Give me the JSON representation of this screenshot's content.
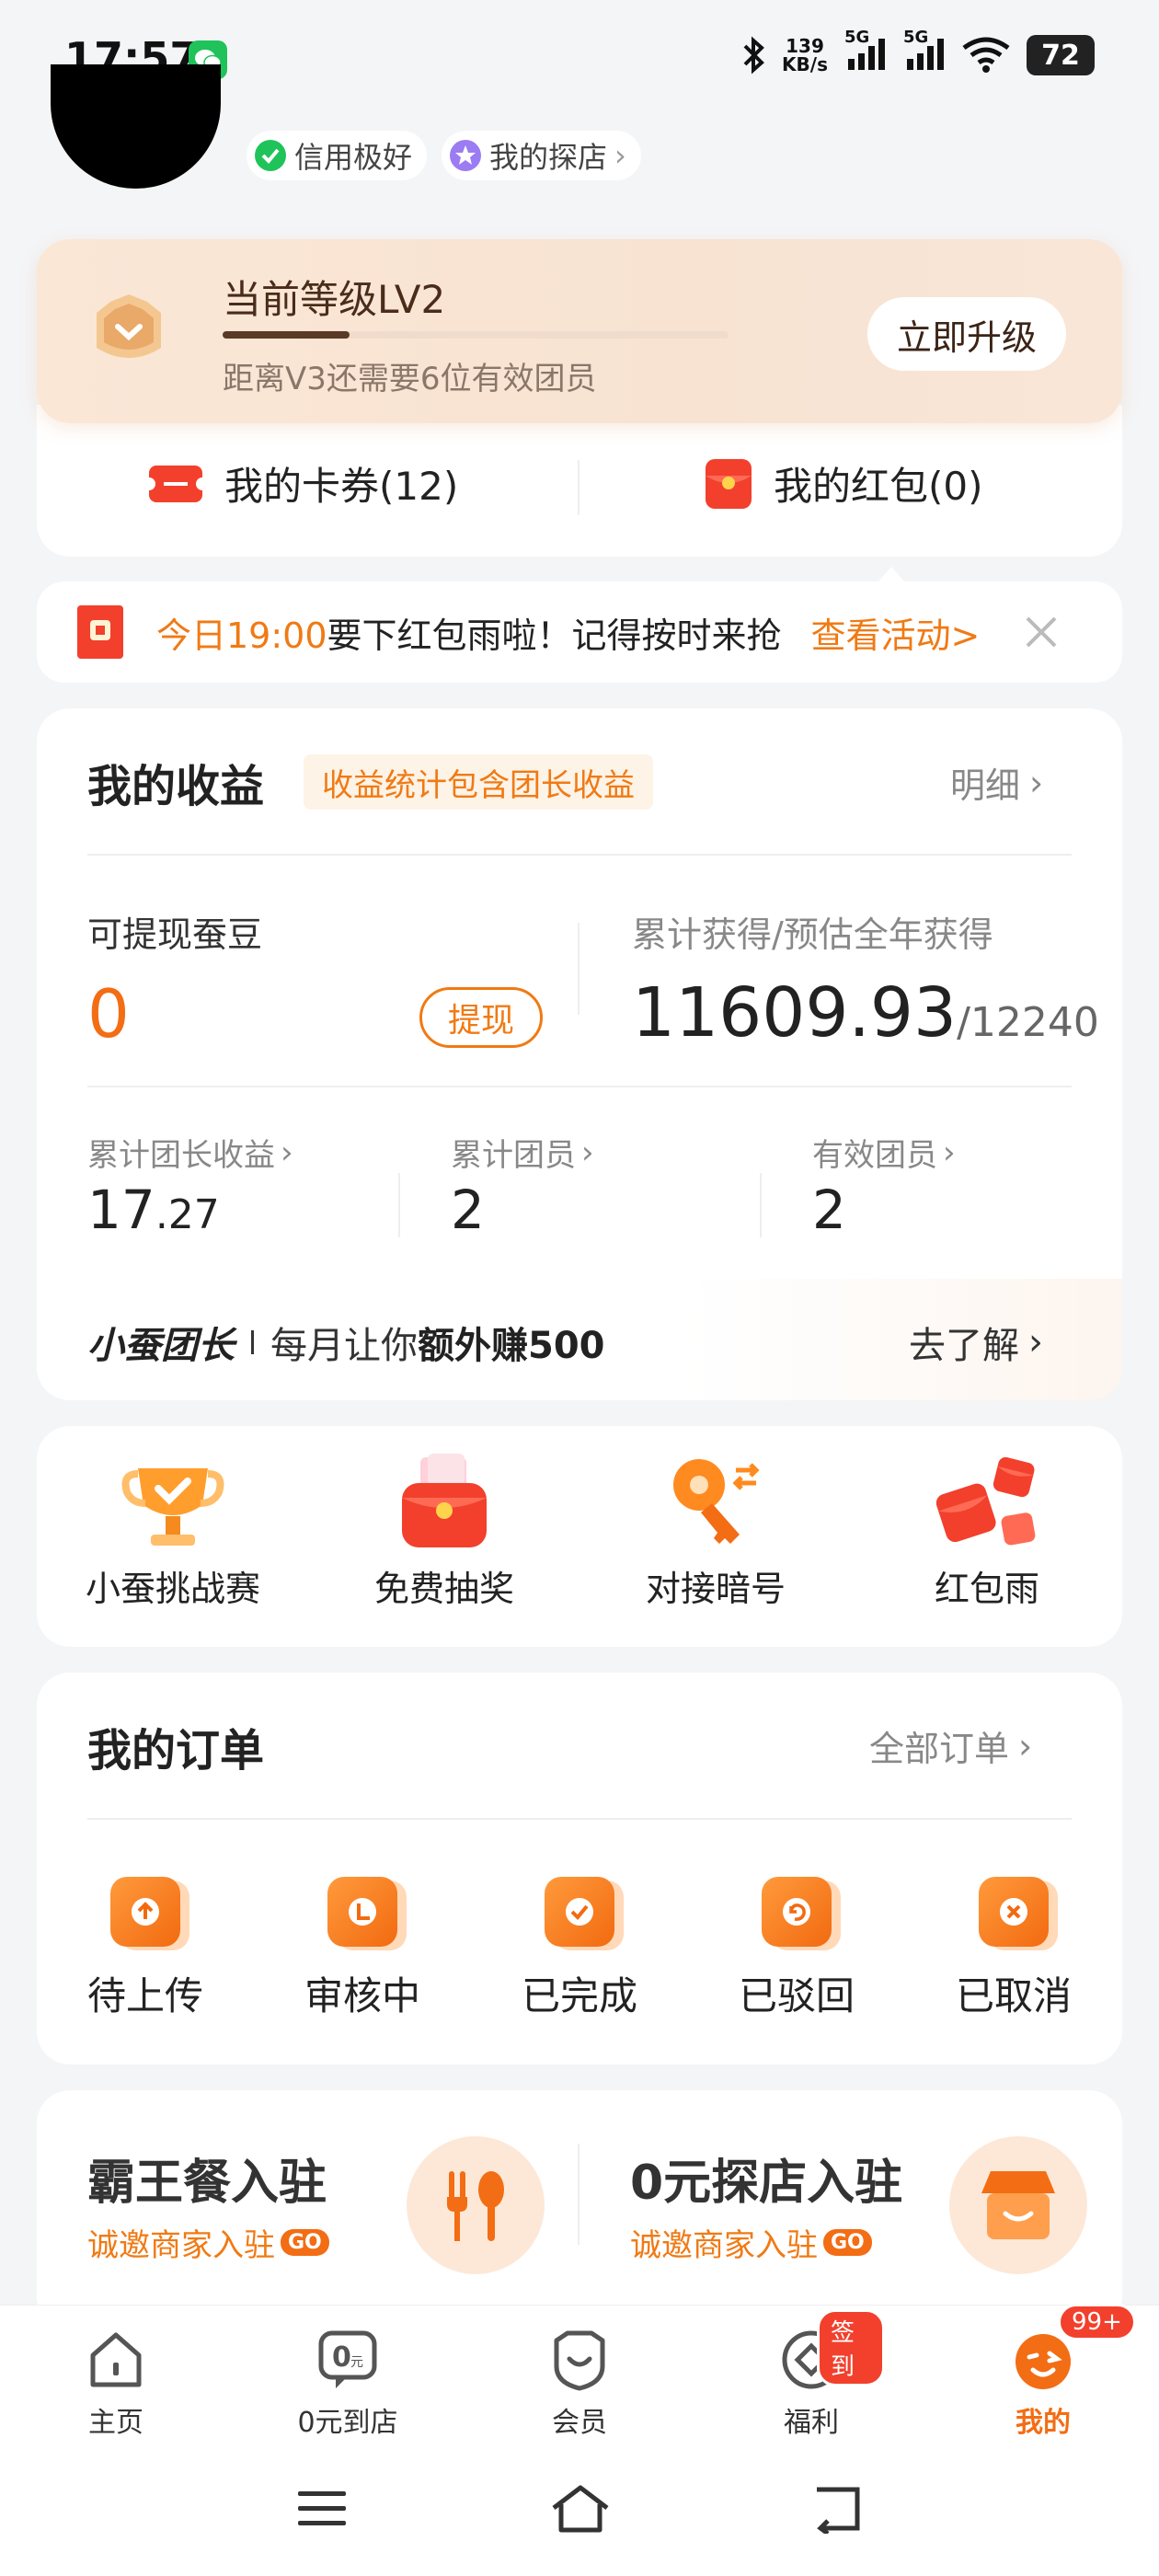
{
  "status_bar": {
    "time": "17:57",
    "net_speed_value": "139",
    "net_speed_unit": "KB/s",
    "sim1": "5G",
    "sim2": "5G",
    "battery": "72"
  },
  "profile": {
    "credit_label": "信用极好",
    "explore_label": "我的探店"
  },
  "level": {
    "title": "当前等级LV2",
    "progress": 0.25,
    "subtitle": "距离V3还需要6位有效团员",
    "upgrade_button": "立即升级"
  },
  "wallet": {
    "coupons_label": "我的卡券(12)",
    "red_packets_label": "我的红包(0)"
  },
  "notice": {
    "time_text": "今日19:00",
    "message": "要下红包雨啦！记得按时来抢",
    "link": "查看活动>"
  },
  "earnings": {
    "title": "我的收益",
    "tag": "收益统计包含团长收益",
    "detail_link": "明细",
    "withdrawable_label": "可提现蚕豆",
    "withdrawable_value": "0",
    "withdraw_button": "提现",
    "cumulative_label": "累计获得/预估全年获得",
    "cumulative_value": "11609.93",
    "annual_estimate": "/12240",
    "stats": [
      {
        "label": "累计团长收益",
        "value_int": "17",
        "value_dec": ".27"
      },
      {
        "label": "累计团员",
        "value_int": "2",
        "value_dec": ""
      },
      {
        "label": "有效团员",
        "value_int": "2",
        "value_dec": ""
      }
    ],
    "team_leader_title": "小蚕团长",
    "team_leader_pre": "每月让你",
    "team_leader_bold": "额外赚500",
    "team_leader_link": "去了解"
  },
  "quick_menu": [
    {
      "label": "小蚕挑战赛",
      "icon": "trophy-icon"
    },
    {
      "label": "免费抽奖",
      "icon": "lottery-box-icon"
    },
    {
      "label": "对接暗号",
      "icon": "key-icon"
    },
    {
      "label": "红包雨",
      "icon": "red-packet-rain-icon"
    }
  ],
  "orders": {
    "title": "我的订单",
    "all_link": "全部订单",
    "items": [
      {
        "label": "待上传",
        "icon": "upload-icon"
      },
      {
        "label": "审核中",
        "icon": "reviewing-icon"
      },
      {
        "label": "已完成",
        "icon": "check-icon"
      },
      {
        "label": "已驳回",
        "icon": "return-icon"
      },
      {
        "label": "已取消",
        "icon": "cancel-icon"
      }
    ]
  },
  "merchant": {
    "left_title": "霸王餐入驻",
    "left_sub": "诚邀商家入驻",
    "right_title": "0元探店入驻",
    "right_sub": "诚邀商家入驻",
    "go": "GO"
  },
  "tabbar": [
    {
      "label": "主页"
    },
    {
      "label": "0元到店"
    },
    {
      "label": "会员"
    },
    {
      "label": "福利",
      "badge": "签到"
    },
    {
      "label": "我的",
      "badge": "99+"
    }
  ],
  "colors": {
    "accent": "#f36d14",
    "red": "#f2402d",
    "background": "#f4f5f7"
  }
}
